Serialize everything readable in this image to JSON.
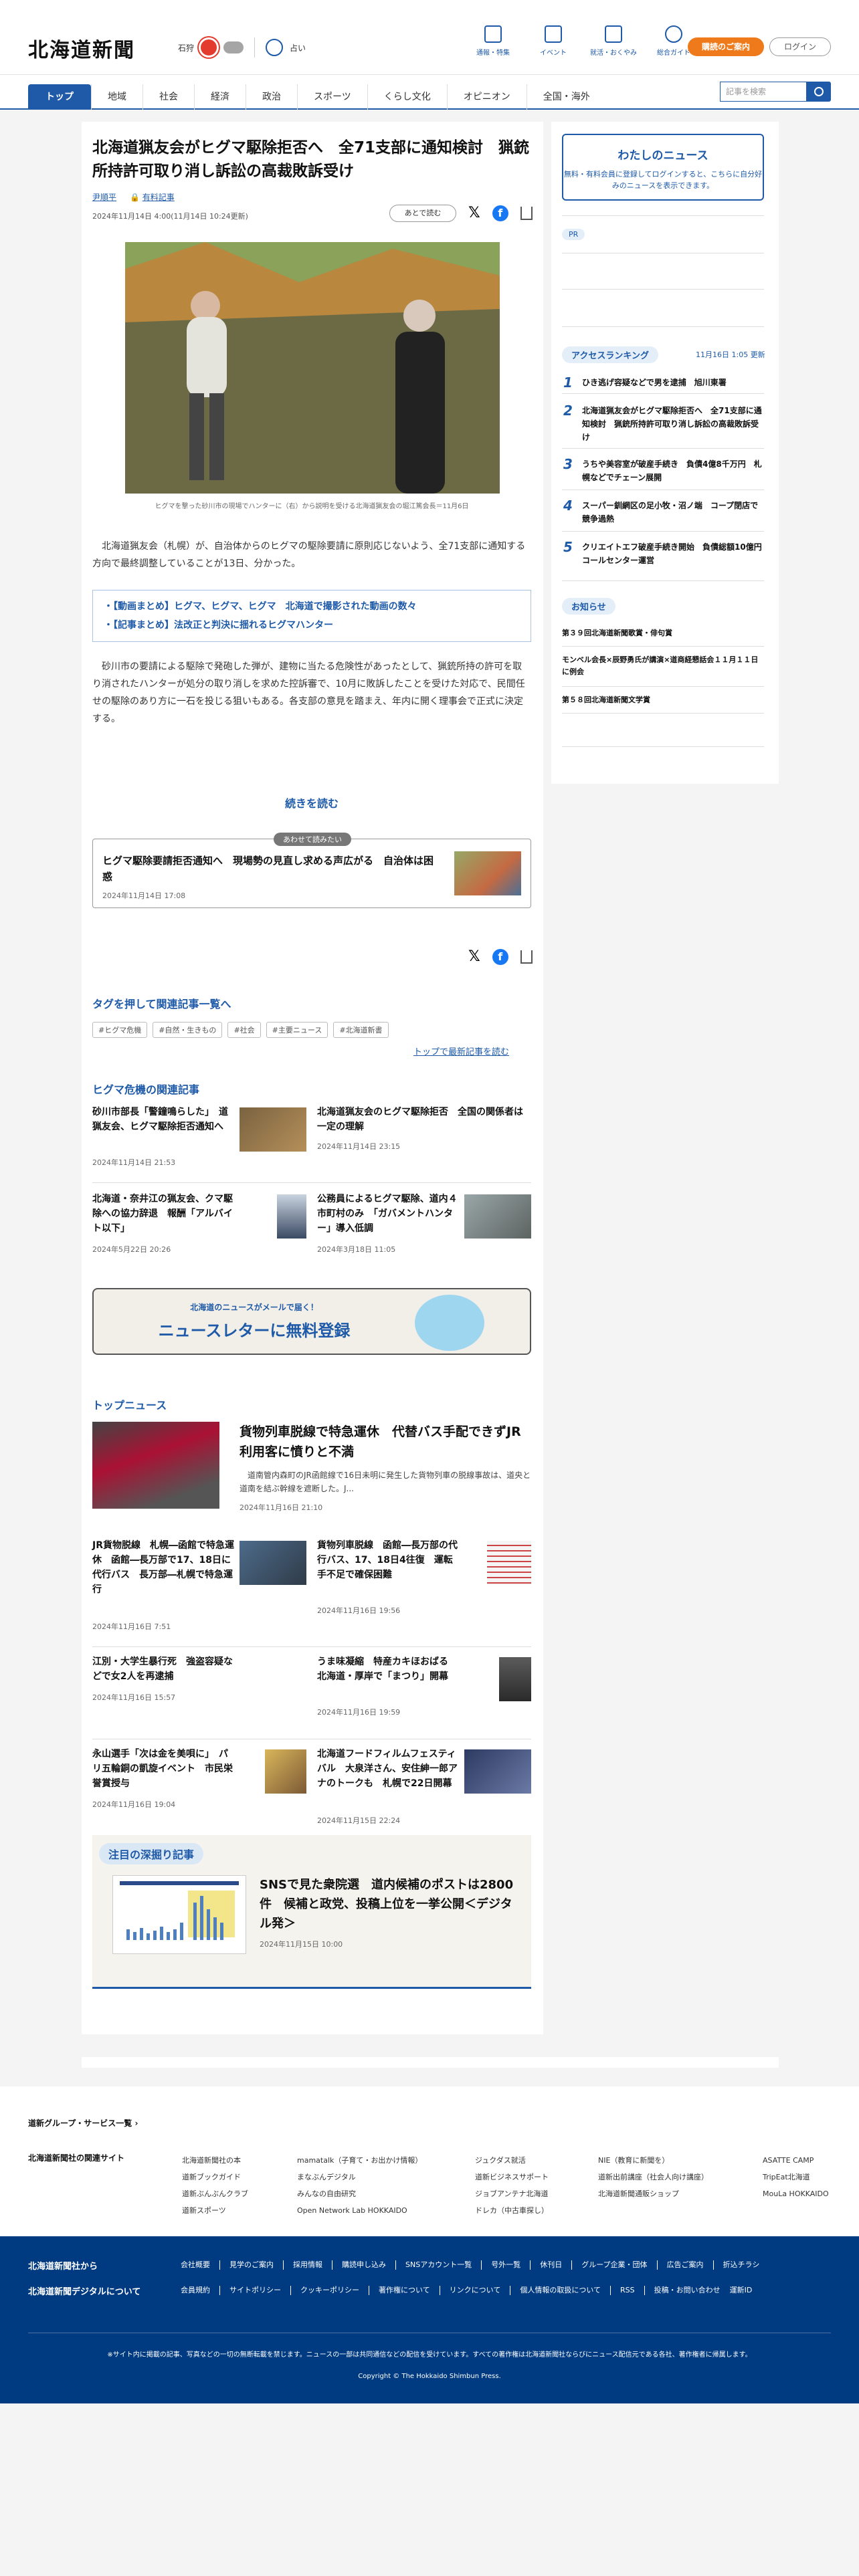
{
  "header": {
    "logo": "北海道新聞",
    "weather_city": "石狩",
    "uv_label": "占い",
    "topnav": [
      "通報・特集",
      "イベント",
      "就活・おくやみ",
      "総合ガイド"
    ],
    "plan_button": "購読のご案内",
    "login_button": "ログイン"
  },
  "nav": {
    "items": [
      "トップ",
      "地域",
      "社会",
      "経済",
      "政治",
      "スポーツ",
      "くらし文化",
      "オピニオン",
      "全国・海外"
    ],
    "search_placeholder": "記事を検索"
  },
  "article": {
    "title": "北海道猟友会がヒグマ駆除拒否へ　全71支部に通知検討　猟銃所持許可取り消し訴訟の高裁敗訴受け",
    "author": "尹順平",
    "paid_label": "有料記事",
    "dates": "2024年11月14日 4:00(11月14日 10:24更新)",
    "read_later": "あとで読む",
    "caption": "ヒグマを撃った砂川市の現場でハンターに（右）から説明を受ける北海道猟友会の堀江篤会長＝11月6日",
    "lead": "北海道猟友会（札幌）が、自治体からのヒグマの駆除要請に原則応じないよう、全71支部に通知する方向で最終調整していることが13日、分かった。",
    "links": [
      "【動画まとめ】ヒグマ、ヒグマ、ヒグマ　北海道で撮影された動画の数々",
      "【記事まとめ】法改正と判決に揺れるヒグマハンター"
    ],
    "body": "砂川市の要請による駆除で発砲した弾が、建物に当たる危険性があったとして、猟銃所持の許可を取り消されたハンターが処分の取り消しを求めた控訴審で、10月に敗訴したことを受けた対応で、民間任せの駆除のあり方に一石を投じる狙いもある。各支部の意見を踏まえ、年内に開く理事会で正式に決定する。",
    "read_more": "続きを読む"
  },
  "also_read": {
    "badge": "あわせて読みたい",
    "title": "ヒグマ駆除要請拒否通知へ　現場勢の見直し求める声広がる　自治体は困惑",
    "date": "2024年11月14日 17:08"
  },
  "tags": {
    "heading": "タグを押して関連記事一覧へ",
    "items": [
      "#ヒグマ危機",
      "#自然・生きもの",
      "#社会",
      "#主要ニュース",
      "#北海道新書"
    ],
    "more": "トップで最新記事を読む"
  },
  "related": {
    "heading": "ヒグマ危機の関連記事",
    "items": [
      {
        "title": "砂川市部長「警鐘鳴らした」　道猟友会、ヒグマ駆除拒否通知へ",
        "date": "2024年11月14日 21:53"
      },
      {
        "title": "北海道猟友会のヒグマ駆除拒否　全国の関係者は一定の理解",
        "date": "2024年11月14日 23:15"
      },
      {
        "title": "北海道・奈井江の猟友会、クマ駆除への協力辞退　報酬「アルバイト以下」",
        "date": "2024年5月22日 20:26"
      },
      {
        "title": "公務員によるヒグマ駆除、道内４市町村のみ　「ガバメントハンター」導入低調",
        "date": "2024年3月18日 11:05"
      }
    ]
  },
  "newsletter": {
    "sub": "北海道のニュースがメールで届く！",
    "main": "ニュースレターに無料登録"
  },
  "top_news": {
    "heading": "トップニュース",
    "feature": {
      "title": "貨物列車脱線で特急運休　代替バス手配できずJR利用客に憤りと不満",
      "summary": "道南管内森町のJR函館線で16日未明に発生した貨物列車の脱線事故は、道央と道南を結ぶ幹線を遮断した。J...",
      "date": "2024年11月16日 21:10"
    },
    "items": [
      {
        "title": "JR貨物脱線　札幌―函館で特急運休　函館―長万部で17、18日に代行バス　長万部―札幌で特急運行",
        "date": "2024年11月16日 7:51"
      },
      {
        "title": "貨物列車脱線　函館―長万部の代行バス、17、18日4往復　運転手不足で確保困難",
        "date": "2024年11月16日 19:56"
      },
      {
        "title": "江別・大学生暴行死　強盗容疑などで女2人を再逮捕",
        "date": "2024年11月16日 15:57"
      },
      {
        "title": "うま味凝縮　特産カキほおばる　北海道・厚岸で「まつり」開幕",
        "date": "2024年11月16日 19:59"
      },
      {
        "title": "永山選手「次は金を美唄に」　パリ五輪銅の凱旋イベント　市民栄誉賞授与",
        "date": "2024年11月16日 19:04"
      },
      {
        "title": "北海道フードフィルムフェスティバル　大泉洋さん、安住紳一郎アナのトークも　札幌で22日開幕",
        "date": "2024年11月15日 22:24"
      }
    ]
  },
  "deep_dive": {
    "label": "注目の深掘り記事",
    "title": "SNSで見た衆院選　道内候補のポストは2800件　候補と政党、投稿上位を一挙公開＜デジタル発＞",
    "date": "2024年11月15日 10:00"
  },
  "sidebar": {
    "mynews_title": "わたしのニュース",
    "mynews_sub": "無料・有料会員に登録してログインすると、こちらに自分好みのニュースを表示できます。",
    "pr_label": "PR",
    "ranking_heading": "アクセスランキング",
    "ranking_date": "11月16日 1:05 更新",
    "ranking": [
      "ひき逃げ容疑などで男を逮捕　旭川東署",
      "北海道猟友会がヒグマ駆除拒否へ　全71支部に通知検討　猟銃所持許可取り消し訴訟の高裁敗訴受け",
      "うちや美容室が破産手続き　負債4億8千万円　札幌などでチェーン展開",
      "スーパー釧網区の足小牧・沼ノ端　コープ閉店で競争過熱",
      "クリエイトエフ破産手続き開始　負債総額10億円　コールセンター運営"
    ],
    "notice_heading": "お知らせ",
    "notices": [
      "第３９回北海道新聞歌賞・俳句賞",
      "モンベル会長×辰野勇氏が講演×道商経懇話会１１月１１日に例会",
      "第５８回北海道新聞文学賞"
    ]
  },
  "footer": {
    "group_link": "道新グループ・サービス一覧",
    "related_sites": "北海道新聞社の関連サイト",
    "col1": [
      "北海道新聞社の本",
      "道新ブックガイド",
      "道新ぶんぶんクラブ",
      "道新スポーツ"
    ],
    "col2": [
      "mamatalk（子育て・お出かけ情報）",
      "まなぶんデジタル",
      "みんなの自由研究",
      "Open Network Lab HOKKAIDO"
    ],
    "col3": [
      "ジュクダス就活",
      "道新ビジネスサポート",
      "ジョブアンテナ北海道",
      "ドレカ（中古車探し）"
    ],
    "col4": [
      "NIE（教育に新聞を）",
      "道新出前講座（社会人向け講座）",
      "北海道新聞通販ショップ"
    ],
    "col5": [
      "ASATTE CAMP",
      "TripEat北海道",
      "MouLa HOKKAIDO"
    ],
    "from_paper": "北海道新聞社から",
    "about_digital": "北海道新聞デジタルについて",
    "links1": [
      "会社概要",
      "見学のご案内",
      "採用情報",
      "購読申し込み",
      "SNSアカウント一覧",
      "号外一覧",
      "休刊日",
      "グループ企業・団体",
      "広告ご案内",
      "折込チラシ"
    ],
    "links2": [
      "会員規約",
      "サイトポリシー",
      "クッキーポリシー",
      "著作権について",
      "リンクについて",
      "個人情報の取扱について",
      "RSS",
      "投稿・お問い合わせ",
      "運新ID"
    ],
    "note": "※サイト内に掲載の記事、写真などの一切の無断転載を禁じます。ニュースの一部は共同通信などの配信を受けています。すべての著作権は北海道新聞社ならびにニュース配信元である各社、著作権者に帰属します。",
    "copyright": "Copyright © The Hokkaido Shimbun Press."
  }
}
